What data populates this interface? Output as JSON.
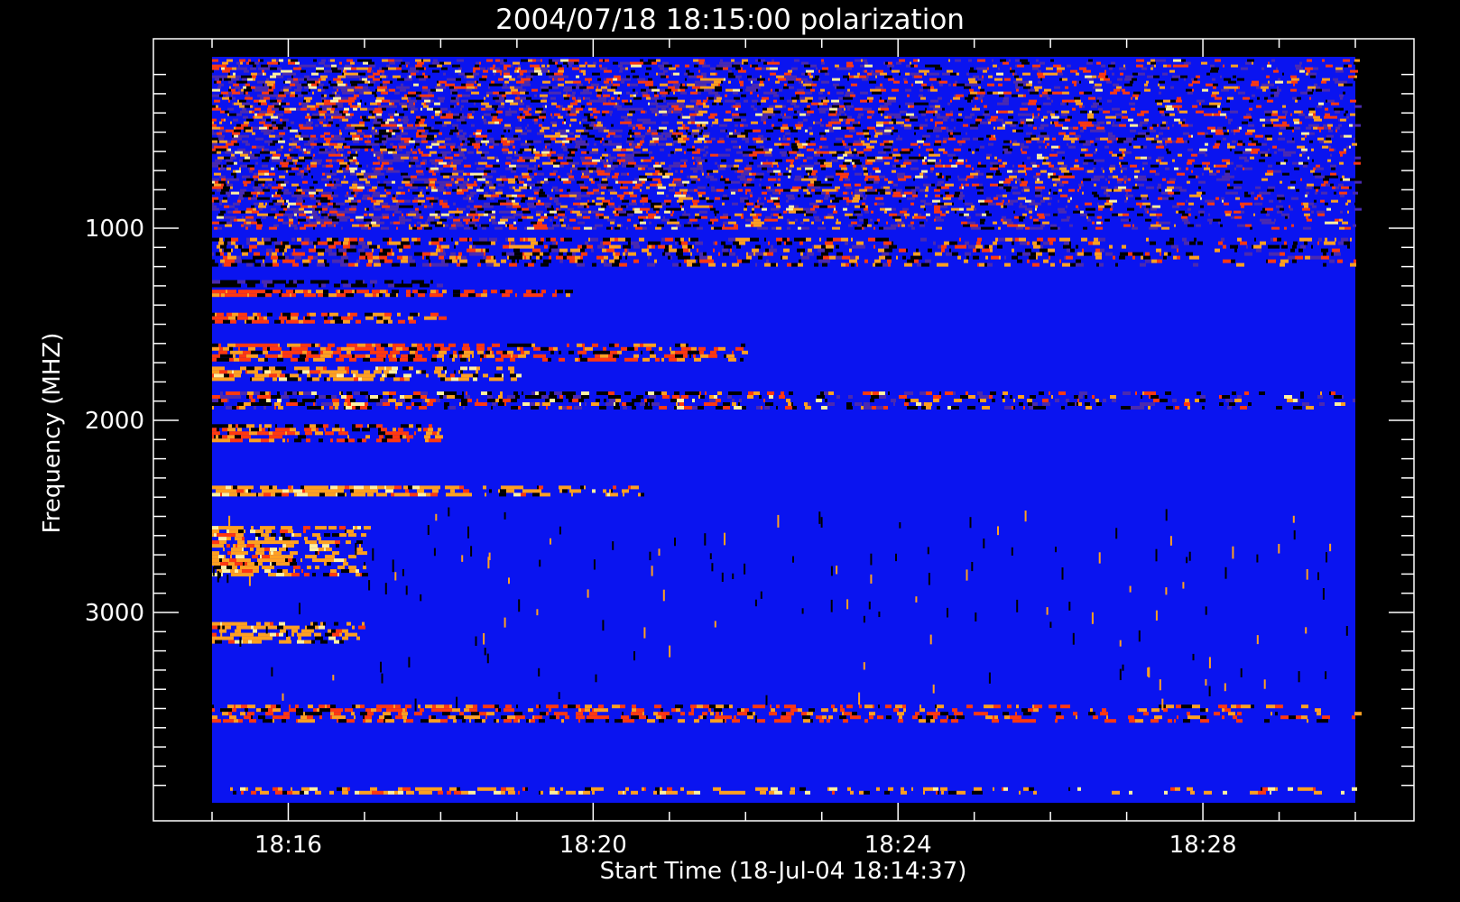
{
  "chart_data": {
    "type": "heatmap",
    "title": "2004/07/18 18:15:00 polarization",
    "xlabel": "Start Time (18-Jul-04 18:14:37)",
    "ylabel": "Frequency (MHZ)",
    "x_range_minutes": [
      "18:15:00",
      "18:30:00"
    ],
    "x_ticks": [
      {
        "label": "18:16",
        "value": "18:16"
      },
      {
        "label": "18:20",
        "value": "18:20"
      },
      {
        "label": "18:24",
        "value": "18:24"
      },
      {
        "label": "18:28",
        "value": "18:28"
      }
    ],
    "y_ticks": [
      {
        "label": "1000",
        "value": 1000
      },
      {
        "label": "2000",
        "value": 2000
      },
      {
        "label": "3000",
        "value": 3000
      }
    ],
    "y_range": [
      100,
      3950
    ],
    "y_inverted": true,
    "colors": {
      "background": "#0a14f0",
      "black": "#000000",
      "red": "#ff3810",
      "orange": "#ffa020",
      "yellow": "#fff0a0",
      "purple": "#4a2ab0"
    },
    "bands": [
      {
        "f0": 120,
        "f1": 1000,
        "pattern": "speckled",
        "activity": 0.55,
        "t_end": "18:30"
      },
      {
        "f0": 1050,
        "f1": 1200,
        "pattern": "striated",
        "activity": 0.6,
        "t_end": "18:30"
      },
      {
        "f0": 1270,
        "f1": 1300,
        "pattern": "solid-black",
        "activity": 0.9,
        "t_end": "18:18"
      },
      {
        "f0": 1320,
        "f1": 1350,
        "pattern": "red-orange",
        "activity": 0.9,
        "t_end": "18:20"
      },
      {
        "f0": 1440,
        "f1": 1480,
        "pattern": "red-orange",
        "activity": 0.9,
        "t_end": "18:18"
      },
      {
        "f0": 1600,
        "f1": 1680,
        "pattern": "red-orange",
        "activity": 0.85,
        "t_end": "18:22"
      },
      {
        "f0": 1720,
        "f1": 1790,
        "pattern": "orange",
        "activity": 0.85,
        "t_end": "18:19"
      },
      {
        "f0": 1850,
        "f1": 1930,
        "pattern": "mixed",
        "activity": 0.6,
        "t_end": "18:30"
      },
      {
        "f0": 2020,
        "f1": 2100,
        "pattern": "red-orange",
        "activity": 0.8,
        "t_end": "18:18"
      },
      {
        "f0": 2340,
        "f1": 2380,
        "pattern": "orange",
        "activity": 0.85,
        "t_end": "18:21"
      },
      {
        "f0": 2550,
        "f1": 2800,
        "pattern": "orange",
        "activity": 0.8,
        "t_end": "18:17"
      },
      {
        "f0": 3050,
        "f1": 3150,
        "pattern": "orange",
        "activity": 0.8,
        "t_end": "18:17"
      },
      {
        "f0": 3480,
        "f1": 3560,
        "pattern": "red-orange",
        "activity": 0.6,
        "t_end": "18:30"
      },
      {
        "f0": 3910,
        "f1": 3940,
        "pattern": "orange",
        "activity": 0.55,
        "t_end": "18:30"
      }
    ]
  }
}
